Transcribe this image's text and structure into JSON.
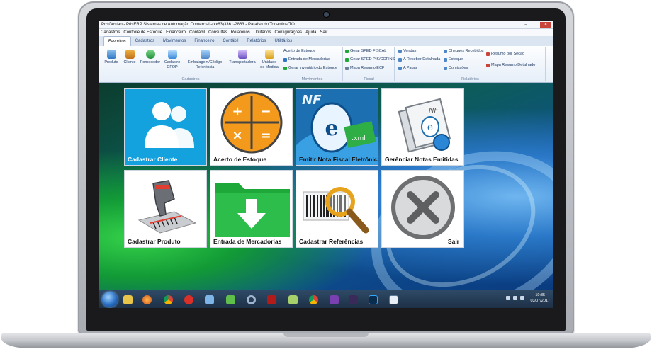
{
  "window": {
    "title": "PrisGestao - PrisERP  Sistemas de Automação Comercial -(xx63)3361-2863 - Paraíso do Tocantins/TO",
    "minimize": "–",
    "maximize": "□",
    "close": "✕"
  },
  "menu": [
    "Cadastros",
    "Controle de Estoque",
    "Financeiro",
    "Contábil",
    "Consultas",
    "Relatórios",
    "Utilitários",
    "Configurações",
    "Ajuda",
    "Sair"
  ],
  "tabs": [
    "Favoritos",
    "Cadastros",
    "Movimentos",
    "Financeiro",
    "Contábil",
    "Relatórios",
    "Utilitários"
  ],
  "ribbon": {
    "cadastros": {
      "label": "Cadastros",
      "buttons": [
        "Produto",
        "Cliente",
        "Fornecedor",
        "Cadastro CFOP",
        "Embalagem/Código Referência",
        "Transportadora",
        "Unidade de Medida"
      ]
    },
    "movimentos": {
      "label": "Movimentos",
      "items": [
        "Acerto de Estoque",
        "Entrada de Mercadorias",
        "Gerar Inventário do Estoque"
      ]
    },
    "fiscal": {
      "label": "Fiscal",
      "items": [
        "Gerar SPED FISCAL",
        "Gerar SPED PIS/COFINS",
        "Mapa Resumo ECF"
      ]
    },
    "relatorios": {
      "label": "Relatórios",
      "col1": [
        "Vendas",
        "A Receber Detalhada",
        "A Pagar"
      ],
      "col2": [
        "Cheques Recebidos",
        "Estoque",
        "Comissões"
      ],
      "col3": [
        "Resumo por Seção",
        "Mapa Resumo Detalhado"
      ]
    }
  },
  "tiles": [
    {
      "label": "Cadastrar Cliente",
      "icon": "users-icon"
    },
    {
      "label": "Acerto de Estoque",
      "icon": "calculator-icon"
    },
    {
      "label": "Emitir Nota Fiscal Eletrônica",
      "icon": "nfe-icon"
    },
    {
      "label": "Gerênciar Notas Emitidas",
      "icon": "nfe-documents-icon"
    },
    {
      "label": "Cadastrar Produto",
      "icon": "barcode-scanner-icon"
    },
    {
      "label": "Entrada de Mercadorias",
      "icon": "folder-download-icon"
    },
    {
      "label": "Cadastrar Referências",
      "icon": "barcode-search-icon"
    },
    {
      "label": "Sair",
      "icon": "exit-icon"
    }
  ],
  "taskbar": {
    "apps": [
      "explorer",
      "firefox",
      "chrome",
      "app-red",
      "notepad",
      "network",
      "media",
      "acrobat",
      "editor",
      "chrome",
      "app-purple",
      "app-dark",
      "photoshop",
      "remote-desktop"
    ],
    "time": "10:35",
    "date": "03/07/2017"
  },
  "colors": {
    "tile_blue": "#13a2dd",
    "orange": "#f39a1c",
    "green_folder": "#1fa83a",
    "ribbon_text": "#1e3a64"
  }
}
